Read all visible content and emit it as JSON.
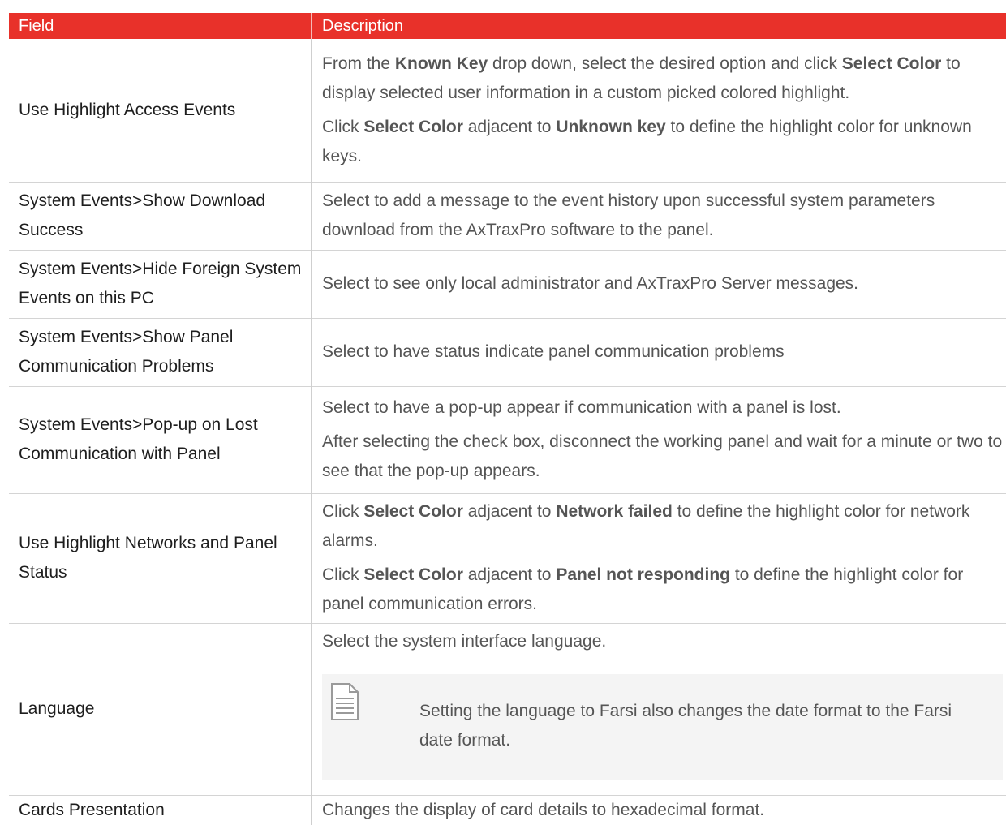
{
  "table": {
    "headers": {
      "field": "Field",
      "description": "Description"
    },
    "rows": [
      {
        "field": "Use Highlight Access Events",
        "desc": [
          {
            "a": "From the ",
            "b1": "Known Key",
            "c": " drop down, select the desired option and click ",
            "b2": "Select Color",
            "d": " to display selected user information in a custom picked colored highlight."
          },
          {
            "a": "Click ",
            "b1": "Select Color",
            "c": " adjacent to ",
            "b2": "Unknown key",
            "d": " to define the highlight color for unknown keys."
          }
        ]
      },
      {
        "field": "System Events>Show Download Success",
        "desc": "Select to add a message to the event history upon successful system parameters download from the AxTraxPro software to the panel."
      },
      {
        "field": "System Events>Hide Foreign System Events on this PC",
        "desc": "Select to see only local administrator and AxTraxPro Server messages."
      },
      {
        "field": "System Events>Show Panel Communication Problems",
        "desc": "Select to have status indicate panel communication problems"
      },
      {
        "field": "System Events>Pop-up on Lost Communication with Panel",
        "desc": [
          "Select to have a pop-up appear if communication with a panel is lost.",
          "After selecting the check box, disconnect the working panel and wait for a minute or two to see that the pop-up appears."
        ]
      },
      {
        "field": "Use Highlight Networks and Panel Status",
        "desc": [
          {
            "a": "Click ",
            "b1": "Select Color",
            "c": " adjacent to ",
            "b2": "Network failed",
            "d": " to define the highlight color for network alarms."
          },
          {
            "a": "Click ",
            "b1": "Select Color",
            "c": " adjacent to ",
            "b2": "Panel not responding",
            "d": " to define the highlight color for panel communication errors."
          }
        ]
      },
      {
        "field": "Language",
        "desc": "Select the system interface language.",
        "note": {
          "icon": "document-note-icon",
          "text": "Setting the language to Farsi also changes the date format to the Farsi date format."
        }
      },
      {
        "field": "Cards Presentation",
        "desc": "Changes the display of card details to hexadecimal format."
      }
    ]
  }
}
